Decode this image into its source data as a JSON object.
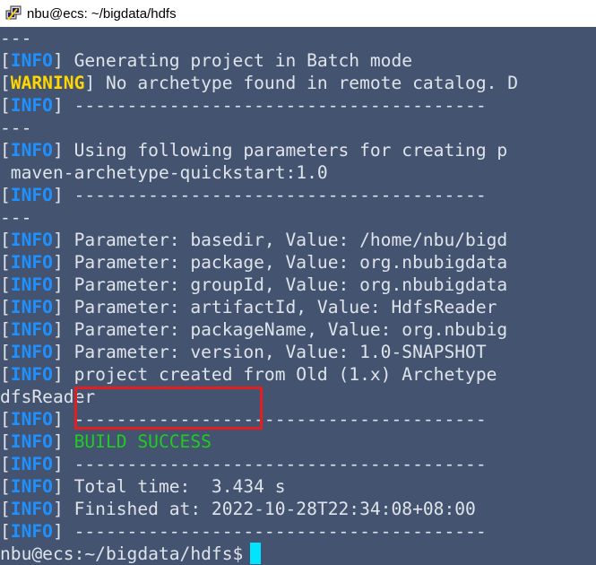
{
  "window": {
    "title": "nbu@ecs: ~/bigdata/hdfs"
  },
  "colors": {
    "background": "#445470",
    "info": "#1e90ff",
    "warning": "#ffd700",
    "success": "#1fcc1f",
    "cursor": "#00e5ff",
    "highlight": "#e41e1e"
  },
  "terminal": {
    "lines": [
      {
        "tag": "",
        "text": "---"
      },
      {
        "tag": "INFO",
        "text": " Generating project in Batch mode"
      },
      {
        "tag": "WARNING",
        "text": " No archetype found in remote catalog. D"
      },
      {
        "tag": "INFO",
        "text": " ---------------------------------------"
      },
      {
        "tag": "",
        "text": "---"
      },
      {
        "tag": "INFO",
        "text": " Using following parameters for creating p"
      },
      {
        "tag": "",
        "text": " maven-archetype-quickstart:1.0"
      },
      {
        "tag": "INFO",
        "text": " ---------------------------------------"
      },
      {
        "tag": "",
        "text": "---"
      },
      {
        "tag": "INFO",
        "text": " Parameter: basedir, Value: /home/nbu/bigd"
      },
      {
        "tag": "INFO",
        "text": " Parameter: package, Value: org.nbubigdata"
      },
      {
        "tag": "INFO",
        "text": " Parameter: groupId, Value: org.nbubigdata"
      },
      {
        "tag": "INFO",
        "text": " Parameter: artifactId, Value: HdfsReader"
      },
      {
        "tag": "INFO",
        "text": " Parameter: packageName, Value: org.nbubig"
      },
      {
        "tag": "INFO",
        "text": " Parameter: version, Value: 1.0-SNAPSHOT"
      },
      {
        "tag": "INFO",
        "text": " project created from Old (1.x) Archetype"
      },
      {
        "tag": "",
        "text": "dfsReader"
      },
      {
        "tag": "INFO",
        "text": " ---------------------------------------"
      },
      {
        "tag": "INFO",
        "text": " BUILD SUCCESS",
        "success": true
      },
      {
        "tag": "INFO",
        "text": " ---------------------------------------"
      },
      {
        "tag": "INFO",
        "text": " Total time:  3.434 s"
      },
      {
        "tag": "INFO",
        "text": " Finished at: 2022-10-28T22:34:08+08:00"
      },
      {
        "tag": "INFO",
        "text": " ---------------------------------------"
      }
    ],
    "prompt": "nbu@ecs:~/bigdata/hdfs$"
  }
}
